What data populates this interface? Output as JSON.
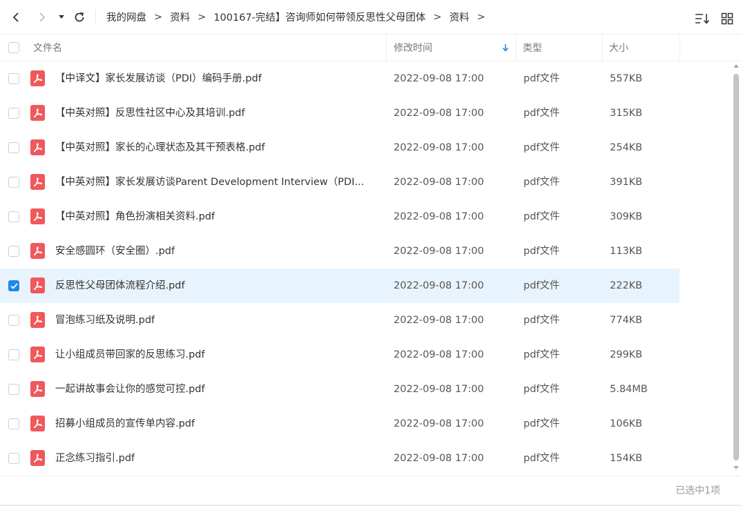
{
  "breadcrumb": {
    "items": [
      "我的网盘",
      "资料",
      "100167-完结】咨询师如何带领反思性父母团体",
      "资料"
    ],
    "separator": ">"
  },
  "columns": {
    "name": "文件名",
    "modified": "修改时间",
    "type": "类型",
    "size": "大小"
  },
  "files": [
    {
      "name": "【中译文】家长发展访谈（PDI）编码手册.pdf",
      "date": "2022-09-08 17:00",
      "type": "pdf文件",
      "size": "557KB",
      "checked": false
    },
    {
      "name": "【中英对照】反思性社区中心及其培训.pdf",
      "date": "2022-09-08 17:00",
      "type": "pdf文件",
      "size": "315KB",
      "checked": false
    },
    {
      "name": "【中英对照】家长的心理状态及其干预表格.pdf",
      "date": "2022-09-08 17:00",
      "type": "pdf文件",
      "size": "254KB",
      "checked": false
    },
    {
      "name": "【中英对照】家长发展访谈Parent Development Interview（PDI...",
      "date": "2022-09-08 17:00",
      "type": "pdf文件",
      "size": "391KB",
      "checked": false
    },
    {
      "name": "【中英对照】角色扮演相关资料.pdf",
      "date": "2022-09-08 17:00",
      "type": "pdf文件",
      "size": "309KB",
      "checked": false
    },
    {
      "name": "安全感圆环（安全圈）.pdf",
      "date": "2022-09-08 17:00",
      "type": "pdf文件",
      "size": "113KB",
      "checked": false
    },
    {
      "name": "反思性父母团体流程介绍.pdf",
      "date": "2022-09-08 17:00",
      "type": "pdf文件",
      "size": "222KB",
      "checked": true
    },
    {
      "name": "冒泡练习纸及说明.pdf",
      "date": "2022-09-08 17:00",
      "type": "pdf文件",
      "size": "774KB",
      "checked": false
    },
    {
      "name": "让小组成员带回家的反思练习.pdf",
      "date": "2022-09-08 17:00",
      "type": "pdf文件",
      "size": "299KB",
      "checked": false
    },
    {
      "name": "一起讲故事会让你的感觉可控.pdf",
      "date": "2022-09-08 17:00",
      "type": "pdf文件",
      "size": "5.84MB",
      "checked": false
    },
    {
      "name": "招募小组成员的宣传单内容.pdf",
      "date": "2022-09-08 17:00",
      "type": "pdf文件",
      "size": "106KB",
      "checked": false
    },
    {
      "name": "正念练习指引.pdf",
      "date": "2022-09-08 17:00",
      "type": "pdf文件",
      "size": "154KB",
      "checked": false
    }
  ],
  "footer": {
    "status": "已选中1项"
  },
  "colors": {
    "accent": "#1e88e5",
    "selected_row": "#e8f4fd",
    "pdf_icon": "#f0585b"
  },
  "icons": {
    "back": "chevron-left-icon",
    "forward": "chevron-right-icon",
    "dropdown": "caret-down-icon",
    "refresh": "refresh-icon",
    "sort": "sort-icon",
    "grid": "grid-view-icon",
    "file": "pdf-file-icon"
  }
}
